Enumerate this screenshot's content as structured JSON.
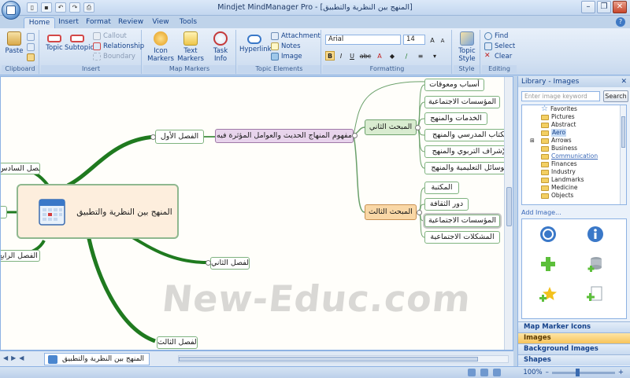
{
  "window": {
    "title": "Mindjet MindManager Pro - [المنهج بين النظرية والتطبيق]",
    "controls": [
      "minimize-icon",
      "restore-icon",
      "close-icon"
    ]
  },
  "tabs": [
    {
      "label": "Home",
      "active": true
    },
    {
      "label": "Insert",
      "active": false
    },
    {
      "label": "Format",
      "active": false
    },
    {
      "label": "Review",
      "active": false
    },
    {
      "label": "View",
      "active": false
    },
    {
      "label": "Tools",
      "active": false
    }
  ],
  "ribbon": {
    "clipboard": {
      "title": "Clipboard",
      "paste": "Paste"
    },
    "insert": {
      "title": "Insert",
      "topic": "Topic",
      "subtopic": "Subtopic",
      "callout": "Callout",
      "relationship": "Relationship",
      "boundary": "Boundary"
    },
    "markers": {
      "title": "Map Markers",
      "icon_markers": "Icon Markers",
      "text_markers": "Text Markers",
      "task_info": "Task Info"
    },
    "elements": {
      "title": "Topic Elements",
      "hyperlink": "Hyperlink",
      "attachment": "Attachment",
      "notes": "Notes",
      "image": "Image"
    },
    "formatting": {
      "title": "Formatting",
      "font": "Arial",
      "size": "14",
      "bold": "B",
      "italic": "I",
      "underline": "U",
      "strike": "abc"
    },
    "style": {
      "title": "Style",
      "topic_style": "Topic Style"
    },
    "editing": {
      "title": "Editing",
      "find": "Find",
      "select": "Select",
      "clear": "Clear"
    }
  },
  "map": {
    "central": "المنهج بين النظرية والتطبيق",
    "chapter1": "الفصل الأول",
    "chapter2": "الفصل الثاني",
    "chapter3": "الفصل الثالث",
    "chapter4": "الفصل الرابع",
    "chapter6": "الفصل السادس",
    "subject1": "مفهوم المنهاج الحديث والعوامل المؤثرة فيه",
    "section2": "المبحث الثاني",
    "section3": "المبحث الثالث",
    "s2_items": [
      "أسباب ومعوقات",
      "المؤسسات الاجتماعية",
      "الخدمات والمنهج",
      "الكتاب المدرسي والمنهج",
      "الإشراف التربوي والمنهج",
      "الوسائل التعليمية والمنهج"
    ],
    "s3_items": [
      "المكتبة",
      "دور الثقافة",
      "المؤسسات الاجتماعية",
      "المشكلات الاجتماعية"
    ],
    "watermark": "New-Educ.com"
  },
  "doc_tab": "المنهج بين النظرية والتطبيق",
  "status": {
    "zoom": "100%"
  },
  "library": {
    "title": "Library - Images",
    "search_placeholder": "Enter image keyword",
    "search_button": "Search",
    "tree": [
      "Favorites",
      "Pictures",
      "Abstract",
      "Aero",
      "Arrows",
      "Business",
      "Communication",
      "Finances",
      "Industry",
      "Landmarks",
      "Medicine",
      "Objects"
    ],
    "add_image": "Add Image...",
    "sections": [
      {
        "label": "Map Marker Icons",
        "active": false
      },
      {
        "label": "Images",
        "active": true
      },
      {
        "label": "Background Images",
        "active": false
      },
      {
        "label": "Shapes",
        "active": false
      }
    ]
  },
  "colors": {
    "branch": "#1f7a1f",
    "central_fill": "#fdeedd",
    "selection": "#c8c8c8"
  }
}
